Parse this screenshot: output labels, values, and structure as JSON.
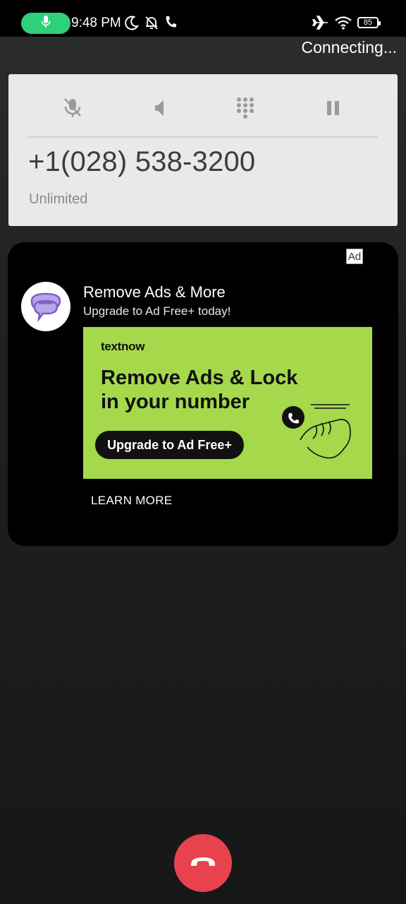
{
  "status_bar": {
    "time": "9:48 PM",
    "battery": "85",
    "accent_color": "#2fd07a",
    "icons": [
      "mic-icon",
      "moon-icon",
      "bell-off-icon",
      "phone-icon",
      "airplane-icon",
      "wifi-icon",
      "battery-icon"
    ]
  },
  "call": {
    "status": "Connecting...",
    "number": "+1(028) 538-3200",
    "plan": "Unlimited",
    "controls": [
      "mute-icon",
      "speaker-icon",
      "dialpad-icon",
      "hold-icon"
    ]
  },
  "ad": {
    "badge": "Ad",
    "title": "Remove Ads & More",
    "subtitle": "Upgrade to Ad Free+ today!",
    "banner": {
      "brand": "textnow",
      "headline": "Remove Ads & Lock in your number",
      "cta": "Upgrade to Ad Free+",
      "background_color": "#a5d84b"
    },
    "learn_more": "LEARN MORE"
  },
  "end_call": {
    "icon": "hang-up-icon",
    "color": "#e8424d"
  }
}
